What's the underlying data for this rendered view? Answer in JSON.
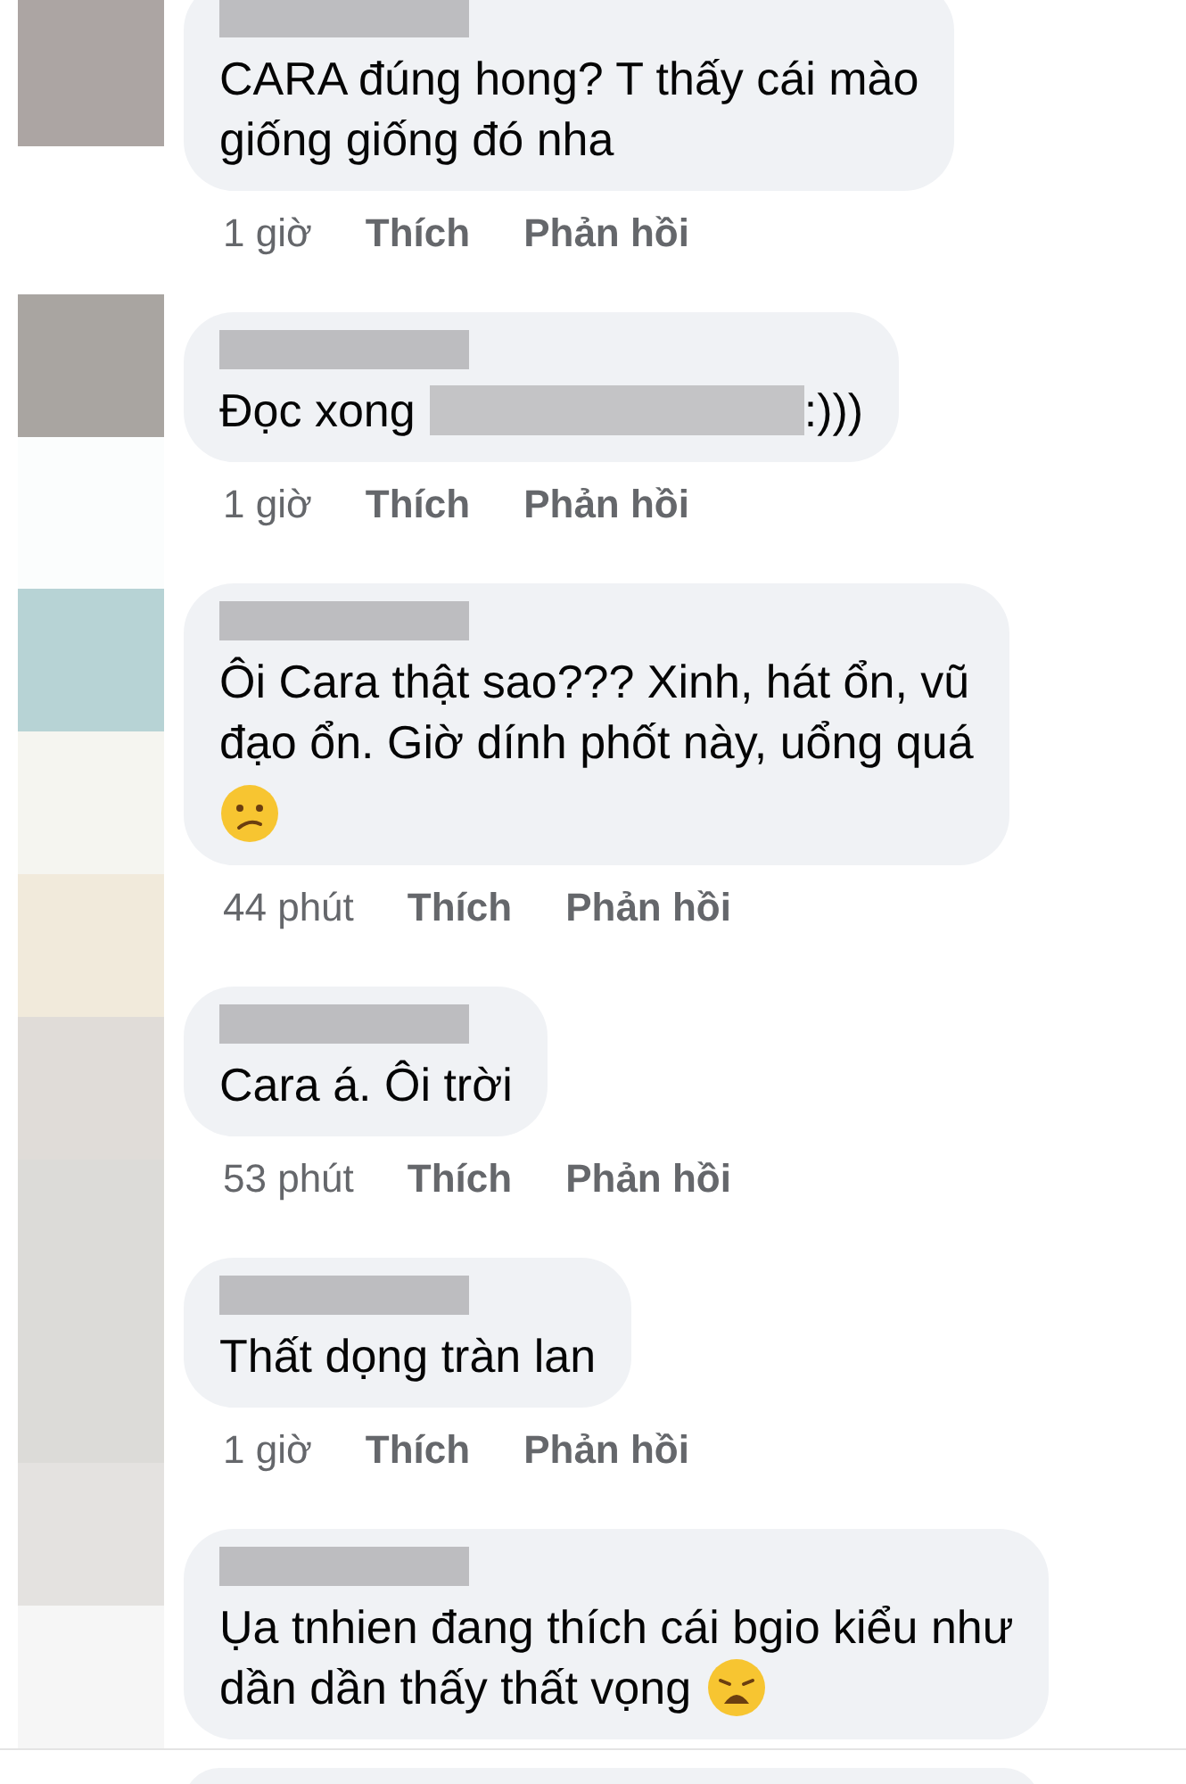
{
  "comments": [
    {
      "name_redacted": true,
      "lines": [
        "CARA đúng hong? T thấy cái mào",
        "giống giống đó nha"
      ],
      "time": "1 giờ",
      "like": "Thích",
      "reply": "Phản hồi"
    },
    {
      "name_redacted": true,
      "lines": [
        "Đọc xong"
      ],
      "redacted_part": true,
      "after_redaction": ":)))",
      "time": "1 giờ",
      "like": "Thích",
      "reply": "Phản hồi"
    },
    {
      "name_redacted": true,
      "lines": [
        "Ôi Cara thật sao??? Xinh, hát ổn, vũ",
        "đạo ổn. Giờ dính phốt này, uổng quá"
      ],
      "emoji": {
        "kind": "confused"
      },
      "emoji_own_line": true,
      "time": "44 phút",
      "like": "Thích",
      "reply": "Phản hồi"
    },
    {
      "name_redacted": true,
      "lines": [
        "Cara á. Ôi trời"
      ],
      "time": "53 phút",
      "like": "Thích",
      "reply": "Phản hồi"
    },
    {
      "name_redacted": true,
      "lines": [
        "Thất dọng tràn lan"
      ],
      "time": "1 giờ",
      "like": "Thích",
      "reply": "Phản hồi"
    },
    {
      "name_redacted": true,
      "lines": [
        "Ụa tnhien đang thích cái bgio kiểu như",
        "dần dần thấy thất vọng"
      ],
      "emoji": {
        "kind": "weary"
      },
      "emoji_own_line": false
    }
  ]
}
